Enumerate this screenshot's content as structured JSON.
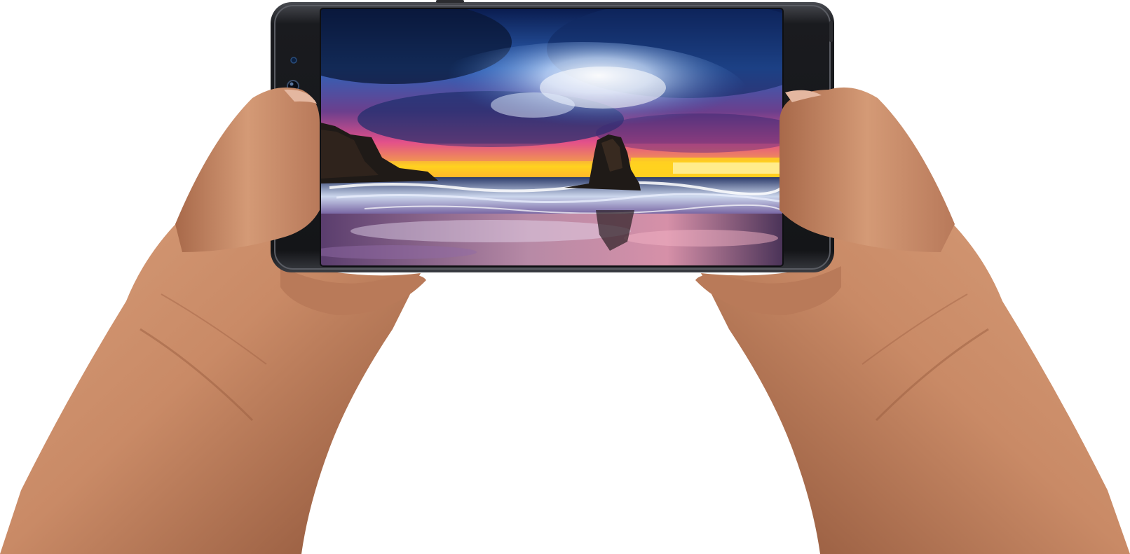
{
  "scene": {
    "background_color": "#ffffff",
    "subject": "smartphone",
    "orientation": "landscape",
    "grip": "two-hands",
    "skin_color": "#c98a66",
    "skin_shadow": "#8d5338",
    "phone_body_color": "#1a1b1f",
    "phone_frame_color": "#3a3c42",
    "screen": {
      "content": "beach-sunset-seascape",
      "sky_colors": [
        "#0a1c4f",
        "#2e63b8",
        "#cfe3ff",
        "#e3508a",
        "#ffd21f"
      ],
      "rock_color": "#1f1a17",
      "sea_colors": [
        "#2b3a6a",
        "#cbd6ec",
        "#6f5a9b"
      ],
      "sand_colors": [
        "#b78aa6",
        "#5a3d6d"
      ]
    },
    "icons": {
      "front_camera": "camera-lens-icon",
      "sensor": "sensor-icon",
      "speaker": "speaker-grille-icon"
    }
  }
}
